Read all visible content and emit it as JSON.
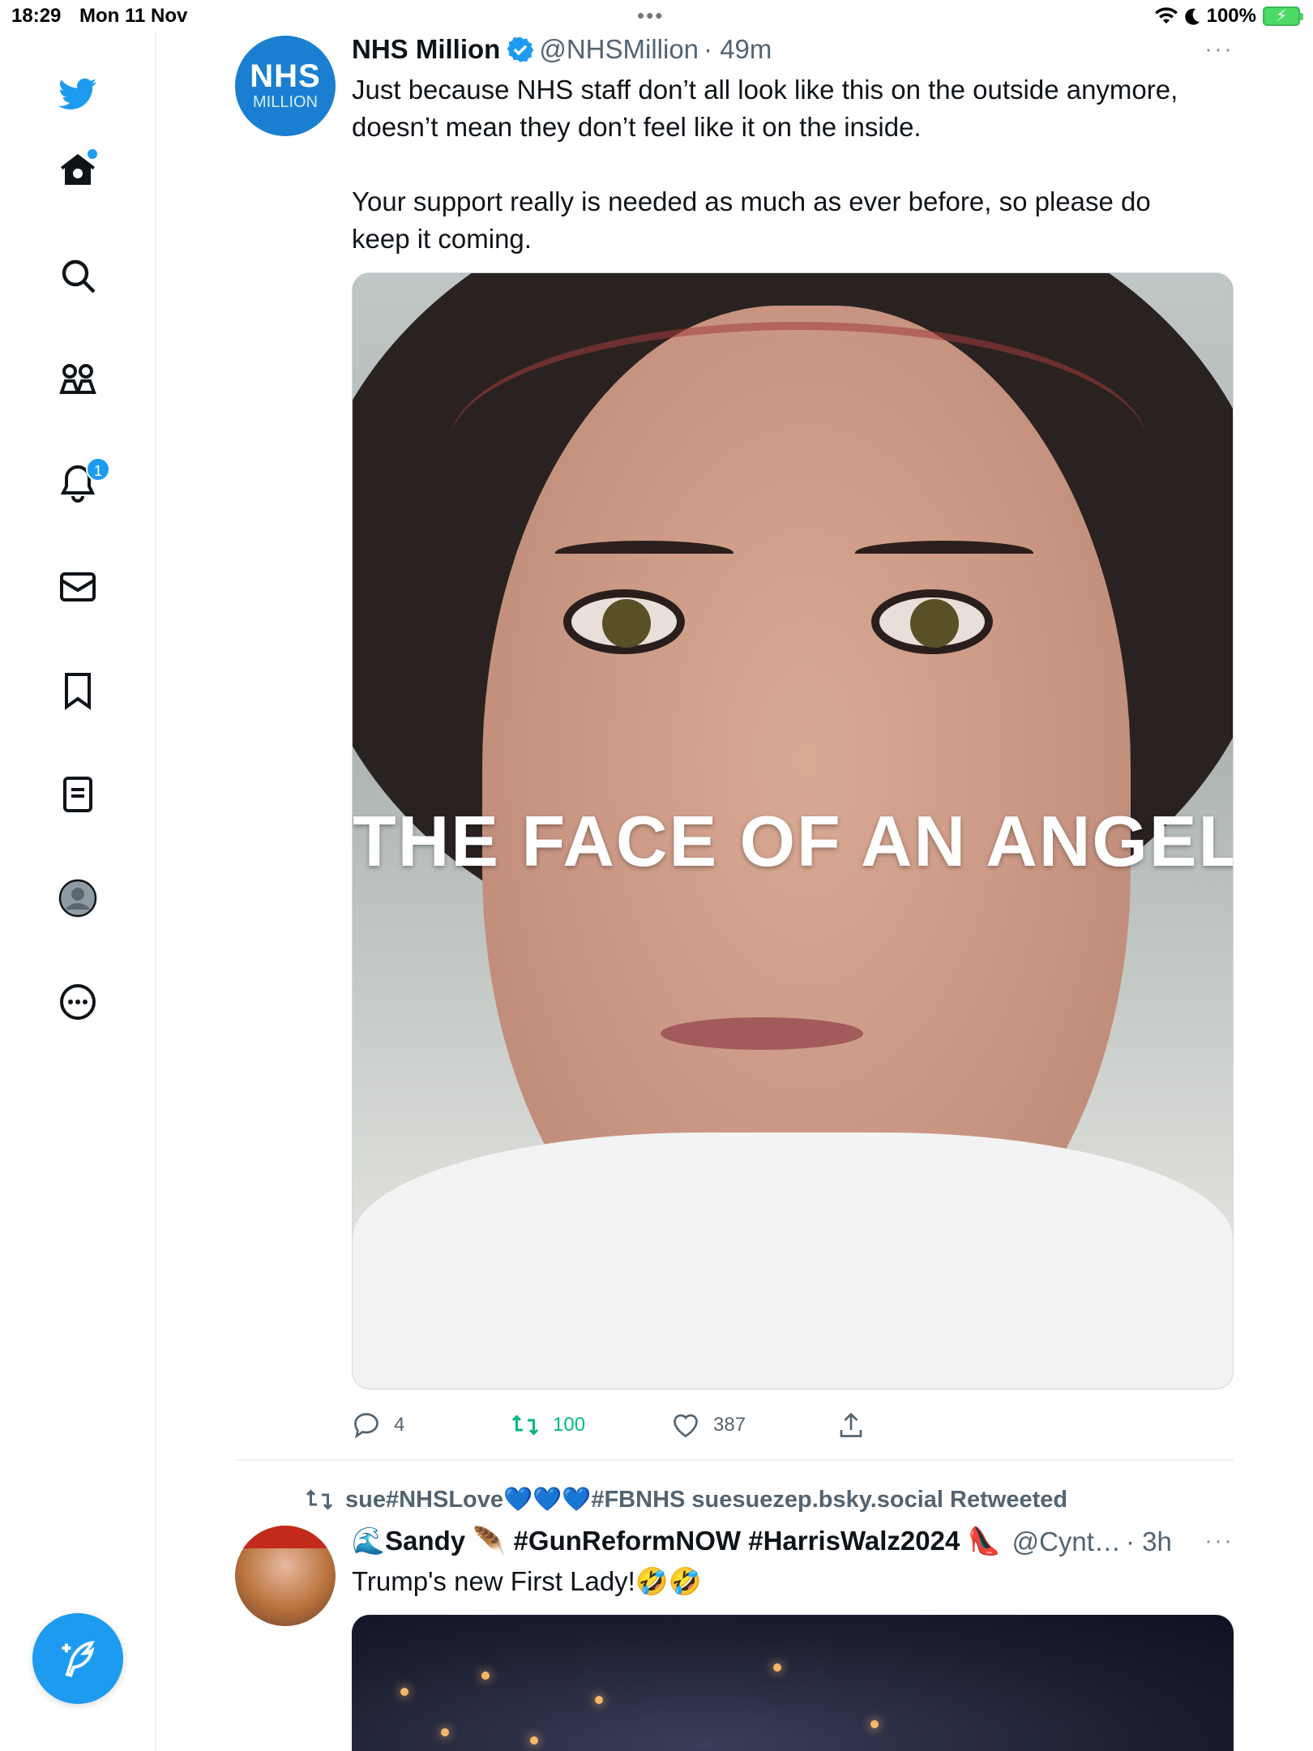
{
  "status_bar": {
    "time": "18:29",
    "date": "Mon 11 Nov",
    "battery": "100%"
  },
  "sidebar": {
    "items": [
      {
        "name": "twitter-logo-icon",
        "label": "Twitter"
      },
      {
        "name": "home-icon",
        "label": "Home"
      },
      {
        "name": "search-icon",
        "label": "Search"
      },
      {
        "name": "communities-icon",
        "label": "Communities"
      },
      {
        "name": "notifications-icon",
        "label": "Notifications"
      },
      {
        "name": "messages-icon",
        "label": "Messages"
      },
      {
        "name": "bookmarks-icon",
        "label": "Bookmarks"
      },
      {
        "name": "lists-icon",
        "label": "Lists"
      },
      {
        "name": "profile-icon",
        "label": "Profile"
      },
      {
        "name": "more-icon",
        "label": "More"
      }
    ],
    "notification_count": "1",
    "compose_icon": "compose-tweet-icon"
  },
  "tweet1": {
    "avatar_top": "NHS",
    "avatar_bottom": "MILLION",
    "name": "NHS Million",
    "handle": "@NHSMillion",
    "time": "· 49m",
    "more": "···",
    "text": "Just because NHS staff don’t all look like this on the outside anymore,\ndoesn’t mean they don’t feel like it on the inside.\n\nYour support really is needed as much as ever before, so please do\nkeep it coming.",
    "media_caption": "THE FACE OF AN ANGEL",
    "replies": "4",
    "retweets": "100",
    "likes": "387"
  },
  "tweet2": {
    "retweeted_by": "sue#NHSLove💙💙💙#FBNHS suesuezep.bsky.social Retweeted",
    "name": "🌊Sandy 🪶 #GunReformNOW #HarrisWalz2024 👠",
    "handle": "@Cynt…",
    "time": "· 3h",
    "more": "···",
    "text": "Trump's new First Lady!🤣🤣"
  },
  "colors": {
    "accent": "#1d9bf0",
    "retweet_green": "#00ba7c",
    "text_secondary": "#536471"
  }
}
